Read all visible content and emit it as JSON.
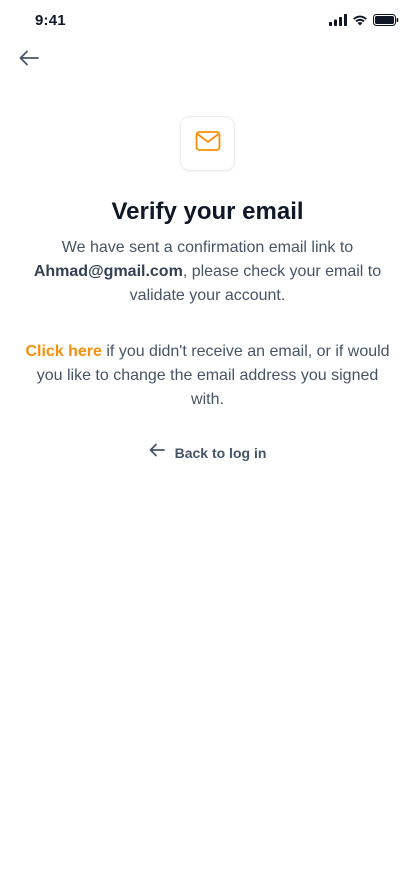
{
  "status_bar": {
    "time": "9:41"
  },
  "header": {
    "back_icon": "arrow-left-icon"
  },
  "main": {
    "badge_icon": "mail-icon",
    "title": "Verify your email",
    "desc_before": "We have sent a confirmation email link to ",
    "email": "Ahmad@gmail.com",
    "desc_after": ", please check your email to validate your account.",
    "resend_link": "Click here",
    "resend_text": " if you didn't receive an email, or if would you like to change the email address you signed with.",
    "back_to_login": "Back to log in"
  },
  "colors": {
    "accent": "#f79009",
    "text_primary": "#101828",
    "text_secondary": "#475467"
  }
}
